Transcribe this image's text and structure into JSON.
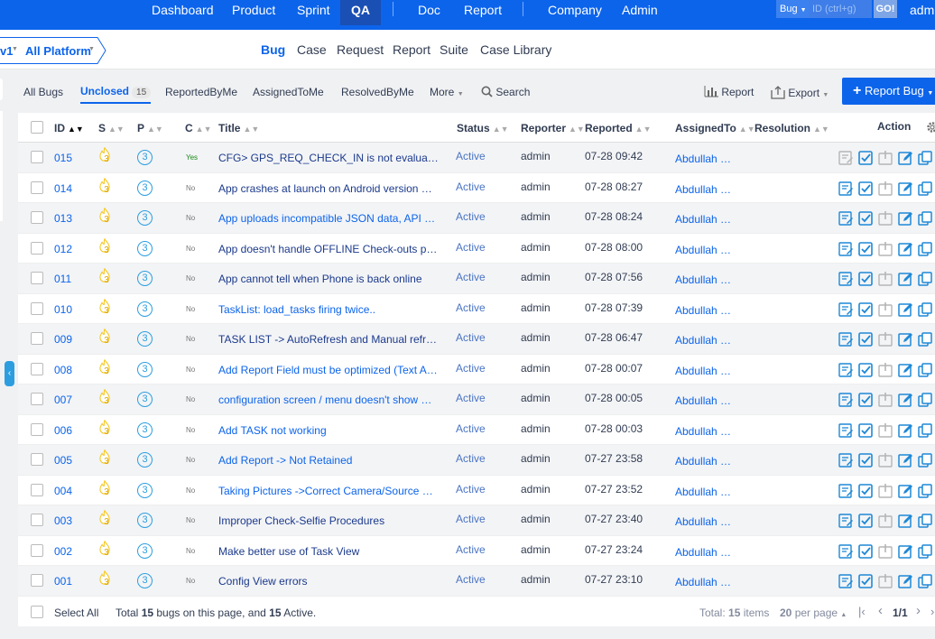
{
  "topnav": {
    "items": [
      "Dashboard",
      "Product",
      "Sprint",
      "QA",
      "Doc",
      "Report",
      "Company",
      "Admin"
    ],
    "active": "QA",
    "search_type": "Bug",
    "search_placeholder": "ID (ctrl+g)",
    "go_label": "GO!",
    "user": "adm"
  },
  "breadcrumb": {
    "product": "v1",
    "platform": "All Platform"
  },
  "subnav": {
    "items": [
      "Bug",
      "Case",
      "Request",
      "Report",
      "Suite",
      "Case Library"
    ],
    "active": "Bug"
  },
  "toolbar": {
    "all_bugs": "All Bugs",
    "unclosed": "Unclosed",
    "unclosed_count": "15",
    "reported_by_me": "ReportedByMe",
    "assigned_to_me": "AssignedToMe",
    "resolved_by_me": "ResolvedByMe",
    "more": "More",
    "search": "Search",
    "report": "Report",
    "export": "Export",
    "report_bug": "Report Bug"
  },
  "table": {
    "headers": {
      "id": "ID",
      "severity": "S",
      "priority": "P",
      "confirmed": "C",
      "title": "Title",
      "status": "Status",
      "reporter": "Reporter",
      "reported": "Reported",
      "assigned_to": "AssignedTo",
      "resolution": "Resolution",
      "action": "Action"
    },
    "rows": [
      {
        "id": "015",
        "sev": "3",
        "pri": "3",
        "conf": "Yes",
        "title": "CFG> GPS_REQ_CHECK_IN is not evalua…",
        "status": "Active",
        "reporter": "admin",
        "reported": "07-28 09:42",
        "assigned": "Abdullah …"
      },
      {
        "id": "014",
        "sev": "3",
        "pri": "3",
        "conf": "No",
        "title": "App crashes at launch on Android version …",
        "status": "Active",
        "reporter": "admin",
        "reported": "07-28 08:27",
        "assigned": "Abdullah …"
      },
      {
        "id": "013",
        "sev": "3",
        "pri": "3",
        "conf": "No",
        "title": "App uploads incompatible JSON data, API …",
        "status": "Active",
        "reporter": "admin",
        "reported": "07-28 08:24",
        "assigned": "Abdullah …"
      },
      {
        "id": "012",
        "sev": "3",
        "pri": "3",
        "conf": "No",
        "title": "App doesn't handle OFFLINE Check-outs p…",
        "status": "Active",
        "reporter": "admin",
        "reported": "07-28 08:00",
        "assigned": "Abdullah …"
      },
      {
        "id": "011",
        "sev": "3",
        "pri": "3",
        "conf": "No",
        "title": "App cannot tell when Phone is back online",
        "status": "Active",
        "reporter": "admin",
        "reported": "07-28 07:56",
        "assigned": "Abdullah …"
      },
      {
        "id": "010",
        "sev": "3",
        "pri": "3",
        "conf": "No",
        "title": "TaskList: load_tasks firing twice..",
        "status": "Active",
        "reporter": "admin",
        "reported": "07-28 07:39",
        "assigned": "Abdullah …"
      },
      {
        "id": "009",
        "sev": "3",
        "pri": "3",
        "conf": "No",
        "title": "TASK LIST -> AutoRefresh and Manual refr…",
        "status": "Active",
        "reporter": "admin",
        "reported": "07-28 06:47",
        "assigned": "Abdullah …"
      },
      {
        "id": "008",
        "sev": "3",
        "pri": "3",
        "conf": "No",
        "title": "Add Report Field must be optimized (Text A…",
        "status": "Active",
        "reporter": "admin",
        "reported": "07-28 00:07",
        "assigned": "Abdullah …"
      },
      {
        "id": "007",
        "sev": "3",
        "pri": "3",
        "conf": "No",
        "title": "configuration screen / menu doesn't show …",
        "status": "Active",
        "reporter": "admin",
        "reported": "07-28 00:05",
        "assigned": "Abdullah …"
      },
      {
        "id": "006",
        "sev": "3",
        "pri": "3",
        "conf": "No",
        "title": "Add TASK not working",
        "status": "Active",
        "reporter": "admin",
        "reported": "07-28 00:03",
        "assigned": "Abdullah …"
      },
      {
        "id": "005",
        "sev": "3",
        "pri": "3",
        "conf": "No",
        "title": "Add Report -> Not Retained",
        "status": "Active",
        "reporter": "admin",
        "reported": "07-27 23:58",
        "assigned": "Abdullah …"
      },
      {
        "id": "004",
        "sev": "3",
        "pri": "3",
        "conf": "No",
        "title": "Taking Pictures ->Correct Camera/Source …",
        "status": "Active",
        "reporter": "admin",
        "reported": "07-27 23:52",
        "assigned": "Abdullah …"
      },
      {
        "id": "003",
        "sev": "3",
        "pri": "3",
        "conf": "No",
        "title": "Improper Check-Selfie Procedures",
        "status": "Active",
        "reporter": "admin",
        "reported": "07-27 23:40",
        "assigned": "Abdullah …"
      },
      {
        "id": "002",
        "sev": "3",
        "pri": "3",
        "conf": "No",
        "title": "Make better use of Task View",
        "status": "Active",
        "reporter": "admin",
        "reported": "07-27 23:24",
        "assigned": "Abdullah …"
      },
      {
        "id": "001",
        "sev": "3",
        "pri": "3",
        "conf": "No",
        "title": "Config View errors",
        "status": "Active",
        "reporter": "admin",
        "reported": "07-27 23:10",
        "assigned": "Abdullah …"
      }
    ]
  },
  "footer": {
    "select_all": "Select All",
    "summary_prefix": "Total ",
    "summary_count": "15",
    "summary_mid": " bugs on this page, and ",
    "summary_active": "15",
    "summary_suffix": " Active.",
    "total_prefix": "Total: ",
    "total_count": "15",
    "total_suffix": " items",
    "per_page_count": "20",
    "per_page_suffix": " per page",
    "page": "1/1"
  },
  "colors": {
    "brand": "#0c64eb",
    "sev_icon": "#f5c518",
    "pri_icon": "#2c9ee0",
    "action_icon": "#1e88d6"
  }
}
